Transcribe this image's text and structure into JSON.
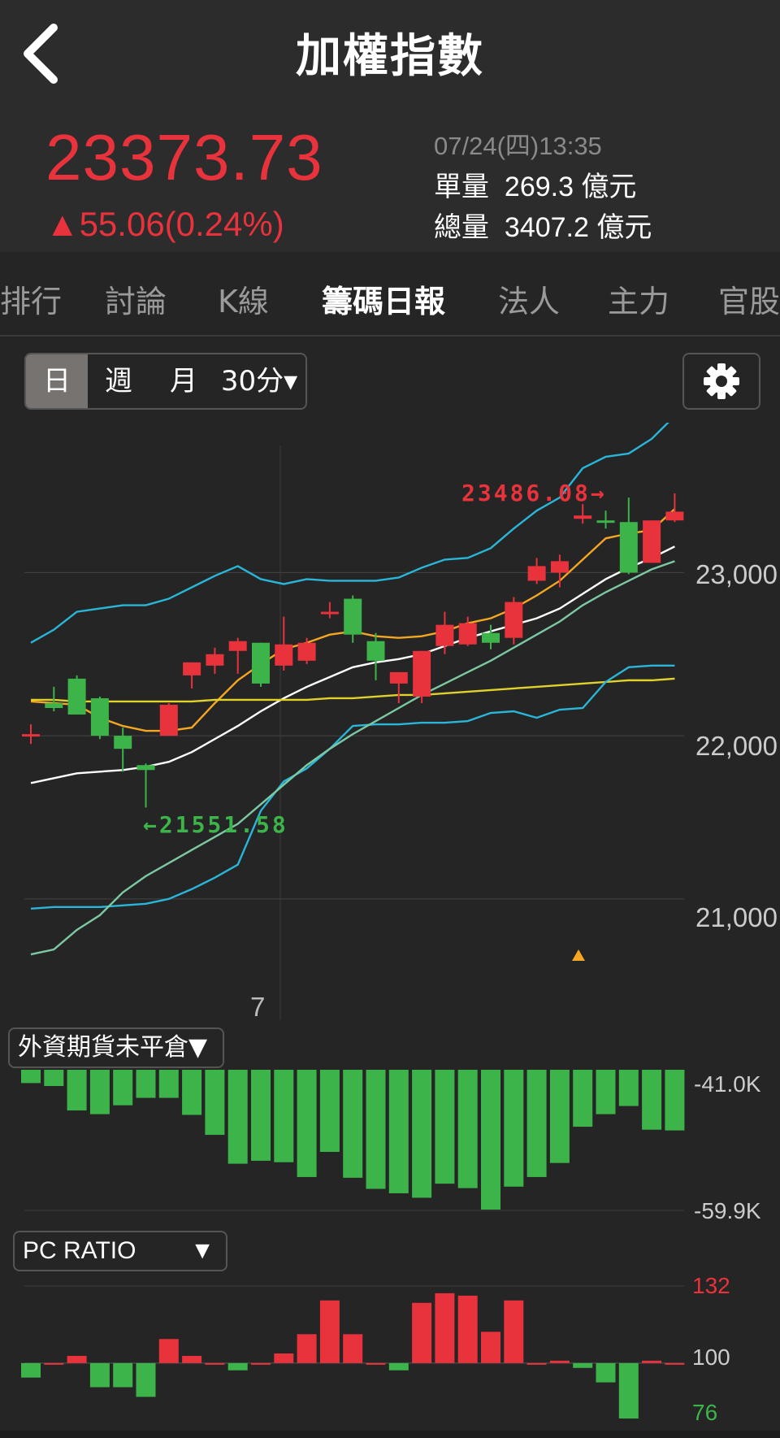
{
  "header": {
    "title": "加權指數",
    "back_icon": "chevron-left-icon"
  },
  "quote": {
    "price": "23373.73",
    "change": "▲55.06(0.24%)",
    "datetime": "07/24(四)13:35",
    "single_label": "單量",
    "single_value": "269.3 億元",
    "total_label": "總量",
    "total_value": "3407.2 億元"
  },
  "tabs": [
    "排行",
    "討論",
    "K線",
    "籌碼日報",
    "法人",
    "主力",
    "官股"
  ],
  "active_tab": "籌碼日報",
  "period": {
    "day": "日",
    "week": "週",
    "month": "月",
    "minute": "30分▾"
  },
  "settings_icon": "gear-icon",
  "colors": {
    "up": "#e8323c",
    "down": "#3cb44a",
    "bg": "#252525"
  },
  "main_chart": {
    "y_labels": [
      "23,000",
      "22,000",
      "21,000"
    ],
    "x_label": "7",
    "high_label": "23486.08→",
    "low_label": "←21551.58"
  },
  "futures_panel": {
    "selector": "外資期貨未平倉▼",
    "axis_top": "-41.0K",
    "axis_bottom": "-59.9K"
  },
  "pc_panel": {
    "selector": "PC RATIO",
    "selector_arrow": "▼",
    "axis_top": "132",
    "axis_mid": "100",
    "axis_bottom": "76"
  },
  "chart_data": [
    {
      "type": "candlestick",
      "y_ticks": [
        23000,
        22000,
        21000
      ],
      "ylim": [
        20730,
        23620
      ],
      "high_marker": 23486.08,
      "low_marker": 21551.58,
      "x_tick": "7",
      "candles": [
        {
          "o": 22000,
          "h": 22070,
          "l": 21950,
          "c": 22010
        },
        {
          "o": 22200,
          "h": 22300,
          "l": 22150,
          "c": 22170
        },
        {
          "o": 22350,
          "h": 22370,
          "l": 22130,
          "c": 22130
        },
        {
          "o": 22230,
          "h": 22240,
          "l": 21980,
          "c": 22000
        },
        {
          "o": 22000,
          "h": 22050,
          "l": 21780,
          "c": 21920
        },
        {
          "o": 21820,
          "h": 21830,
          "l": 21560,
          "c": 21790
        },
        {
          "o": 22000,
          "h": 22200,
          "l": 22000,
          "c": 22190
        },
        {
          "o": 22370,
          "h": 22440,
          "l": 22290,
          "c": 22450
        },
        {
          "o": 22430,
          "h": 22540,
          "l": 22380,
          "c": 22500
        },
        {
          "o": 22520,
          "h": 22600,
          "l": 22380,
          "c": 22580
        },
        {
          "o": 22570,
          "h": 22570,
          "l": 22300,
          "c": 22320
        },
        {
          "o": 22430,
          "h": 22730,
          "l": 22400,
          "c": 22560
        },
        {
          "o": 22460,
          "h": 22600,
          "l": 22440,
          "c": 22570
        },
        {
          "o": 22750,
          "h": 22820,
          "l": 22720,
          "c": 22760
        },
        {
          "o": 22840,
          "h": 22860,
          "l": 22570,
          "c": 22620
        },
        {
          "o": 22580,
          "h": 22630,
          "l": 22340,
          "c": 22460
        },
        {
          "o": 22320,
          "h": 22380,
          "l": 22200,
          "c": 22390
        },
        {
          "o": 22240,
          "h": 22520,
          "l": 22200,
          "c": 22520
        },
        {
          "o": 22550,
          "h": 22760,
          "l": 22500,
          "c": 22680
        },
        {
          "o": 22560,
          "h": 22730,
          "l": 22550,
          "c": 22690
        },
        {
          "o": 22630,
          "h": 22680,
          "l": 22530,
          "c": 22570
        },
        {
          "o": 22600,
          "h": 22850,
          "l": 22560,
          "c": 22820
        },
        {
          "o": 22950,
          "h": 23090,
          "l": 22930,
          "c": 23040
        },
        {
          "o": 23000,
          "h": 23110,
          "l": 22910,
          "c": 23070
        },
        {
          "o": 23330,
          "h": 23420,
          "l": 23300,
          "c": 23350
        },
        {
          "o": 23320,
          "h": 23380,
          "l": 23270,
          "c": 23310
        },
        {
          "o": 23310,
          "h": 23460,
          "l": 22990,
          "c": 23000
        },
        {
          "o": 23060,
          "h": 23320,
          "l": 23060,
          "c": 23320
        },
        {
          "o": 23320,
          "h": 23486.08,
          "l": 23310,
          "c": 23373.73
        }
      ],
      "series": [
        {
          "color": "#f5a623",
          "values": [
            22210,
            22200,
            22190,
            22110,
            22060,
            22030,
            22030,
            22050,
            22200,
            22340,
            22440,
            22530,
            22570,
            22620,
            22640,
            22610,
            22600,
            22610,
            22640,
            22690,
            22720,
            22780,
            22860,
            22950,
            23080,
            23210,
            23240,
            23260,
            23390
          ]
        },
        {
          "color": "#ffffff",
          "values": [
            21710,
            21740,
            21770,
            21780,
            21790,
            21810,
            21840,
            21900,
            21980,
            22060,
            22150,
            22230,
            22300,
            22360,
            22420,
            22450,
            22470,
            22500,
            22550,
            22600,
            22640,
            22680,
            22720,
            22780,
            22870,
            22960,
            23030,
            23090,
            23160
          ]
        },
        {
          "color": "#e0d22a",
          "values": [
            22220,
            22220,
            22210,
            22210,
            22210,
            22210,
            22210,
            22210,
            22220,
            22220,
            22220,
            22220,
            22220,
            22230,
            22230,
            22240,
            22250,
            22250,
            22260,
            22270,
            22280,
            22290,
            22300,
            22310,
            22320,
            22330,
            22340,
            22340,
            22350
          ]
        },
        {
          "color": "#29b6d8",
          "values": [
            22570,
            22650,
            22760,
            22780,
            22800,
            22800,
            22840,
            22910,
            22980,
            23040,
            22960,
            22930,
            22960,
            22950,
            22950,
            22950,
            22970,
            23030,
            23080,
            23090,
            23150,
            23270,
            23380,
            23460,
            23640,
            23710,
            23730,
            23820,
            23960
          ]
        },
        {
          "color": "#29b6d8",
          "values": [
            20940,
            20950,
            20950,
            20950,
            20960,
            20970,
            21000,
            21060,
            21130,
            21210,
            21540,
            21720,
            21800,
            21920,
            22060,
            22070,
            22070,
            22080,
            22080,
            22090,
            22140,
            22150,
            22110,
            22160,
            22170,
            22330,
            22420,
            22430,
            22430
          ]
        },
        {
          "color": "#7cc9a4",
          "values": [
            20660,
            20690,
            20810,
            20900,
            21040,
            21140,
            21220,
            21300,
            21380,
            21460,
            21580,
            21700,
            21820,
            21920,
            22010,
            22090,
            22170,
            22250,
            22320,
            22390,
            22460,
            22540,
            22620,
            22700,
            22800,
            22880,
            22950,
            23020,
            23070
          ]
        }
      ]
    },
    {
      "type": "bar",
      "title": "外資期貨未平倉",
      "ylim": [
        -59.9,
        -41.0
      ],
      "values": [
        -42.8,
        -43.2,
        -46.5,
        -47.0,
        -45.8,
        -44.8,
        -44.8,
        -47.1,
        -49.8,
        -53.7,
        -53.3,
        -53.5,
        -55.5,
        -52.1,
        -55.6,
        -57.1,
        -57.7,
        -58.3,
        -56.4,
        -57.0,
        -59.9,
        -56.8,
        -55.5,
        -53.6,
        -48.7,
        -47.0,
        -45.9,
        -49.1,
        -49.2
      ]
    },
    {
      "type": "bar",
      "title": "PC RATIO",
      "ylim": [
        76,
        132
      ],
      "baseline": 100,
      "values": [
        94,
        100,
        103,
        90,
        90,
        86,
        110,
        103,
        100,
        97,
        100,
        104,
        112,
        126,
        112,
        100,
        97,
        125,
        129,
        128,
        113,
        126,
        100,
        101,
        98,
        92,
        77,
        101,
        100
      ]
    }
  ]
}
